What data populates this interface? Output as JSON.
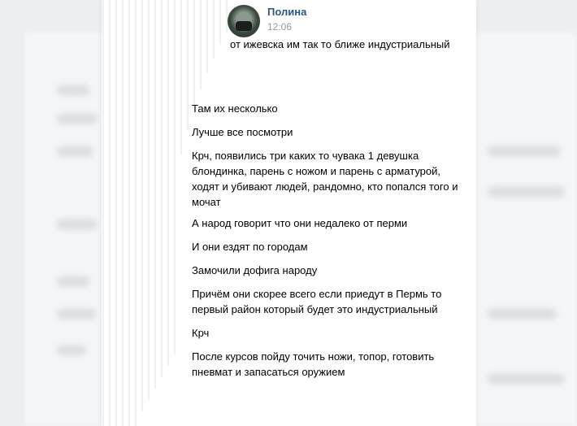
{
  "post": {
    "author": "Полина",
    "time": "12:06",
    "first_line": "от ижевска им так то ближе индустриальный"
  },
  "messages": [
    "Там их несколько",
    "Лучше все посмотри",
    "Крч, появились три каких то чувака 1 девушка блондинка, парень с ножом и парень с арматурой, ходят и убивают людей, рандомно, кто попался того и мочат",
    "А народ говорит что они недалеко от перми",
    "И они ездят по городам",
    "Замочили дофига народу",
    "Причём они скорее всего если приедут в Пермь то первый район который будет это индустриальный",
    "Крч",
    "После курсов пойду точить ножи, топор, готовить пневмат и запасаться оружием"
  ],
  "colors": {
    "author": "#2a5885",
    "time": "#939aa3",
    "text": "#000000"
  }
}
